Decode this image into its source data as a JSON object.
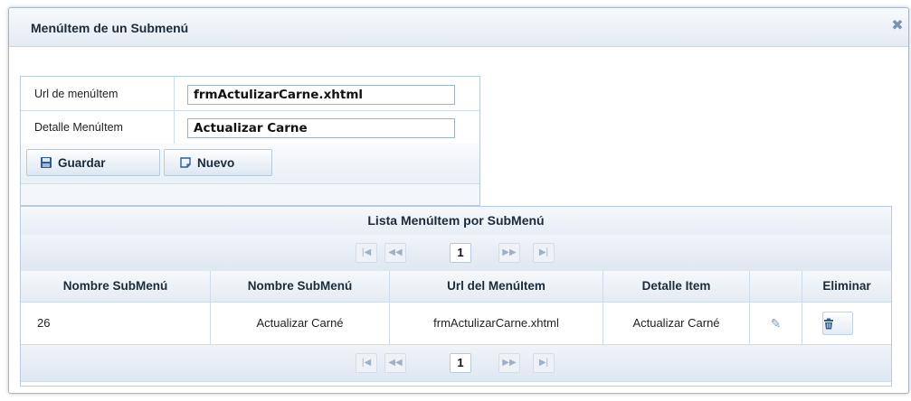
{
  "dialog": {
    "title": "MenúItem de un Submenú",
    "close_icon": "close-icon"
  },
  "form": {
    "url_label": "Url de menúItem",
    "url_value": "frmActulizarCarne.xhtml",
    "detalle_label": "Detalle MenúItem",
    "detalle_value": "Actualizar Carne",
    "guardar_label": "Guardar",
    "guardar_icon": "save-icon",
    "nuevo_label": "Nuevo",
    "nuevo_icon": "new-document-icon"
  },
  "table": {
    "caption": "Lista MenúItem por SubMenú",
    "current_page": "1",
    "columns": [
      "Nombre SubMenú",
      "Nombre SubMenú",
      "Url del MenúItem",
      "Detalle Item",
      "",
      "Eliminar"
    ],
    "rows": [
      {
        "id": "26",
        "nombre": "Actualizar Carné",
        "url": "frmActulizarCarne.xhtml",
        "detalle": "Actualizar Carné"
      }
    ],
    "edit_icon": "pencil-icon",
    "delete_icon": "trash-icon"
  },
  "colors": {
    "accent": "#2d5d94",
    "border": "#b9cbe0",
    "header_bg": "#e4ebf3"
  }
}
